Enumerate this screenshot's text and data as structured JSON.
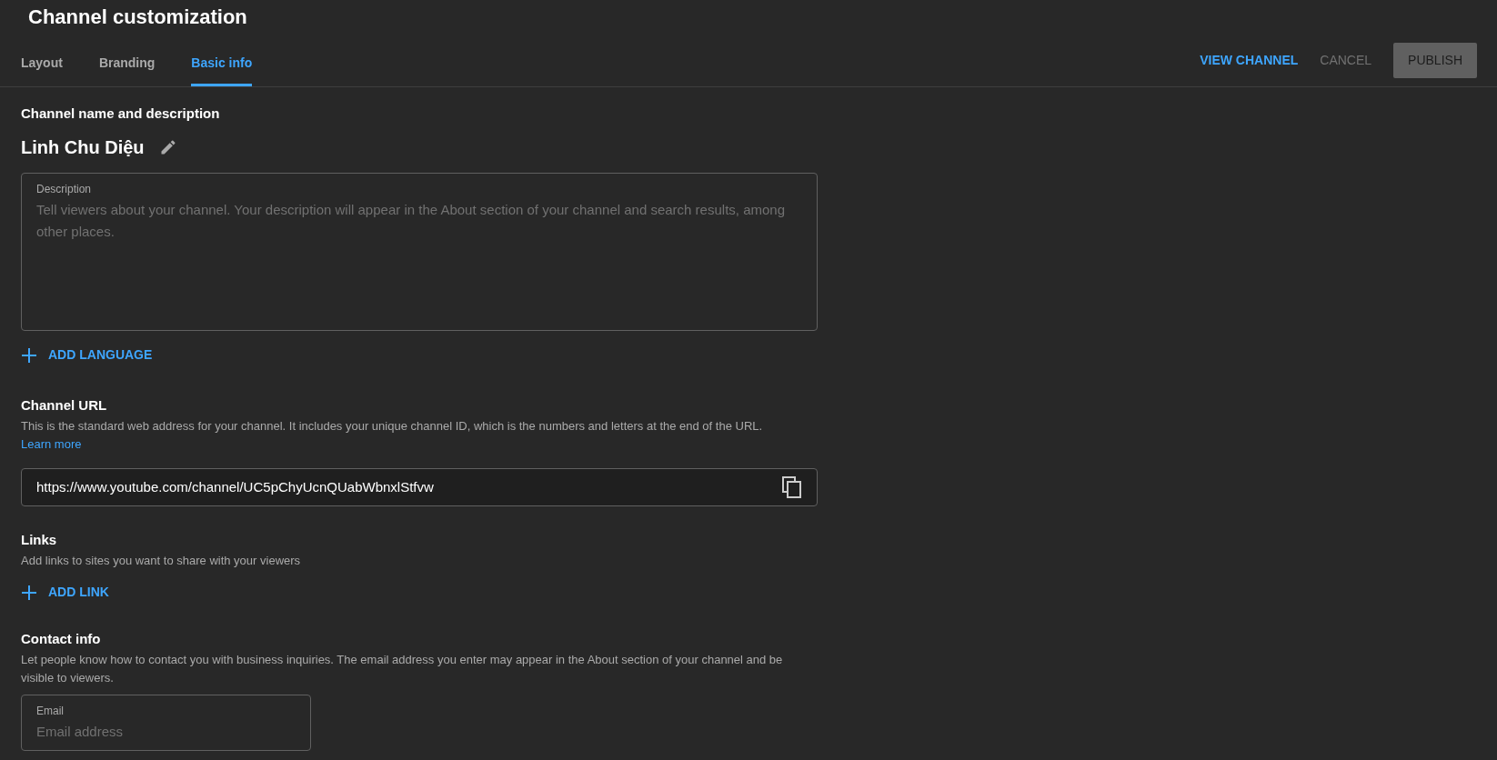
{
  "header": {
    "title": "Channel customization"
  },
  "tabs": [
    {
      "label": "Layout",
      "selected": false
    },
    {
      "label": "Branding",
      "selected": false
    },
    {
      "label": "Basic info",
      "selected": true
    }
  ],
  "actions": [
    {
      "label": "VIEW CHANNEL",
      "kind": "link"
    },
    {
      "label": "CANCEL",
      "kind": "text"
    },
    {
      "label": "PUBLISH",
      "kind": "filled",
      "disabled": true
    }
  ],
  "name_section": {
    "heading": "Channel name and description",
    "channel_name": "Linh Chu Diệu",
    "description_field": {
      "label": "Description",
      "placeholder": "Tell viewers about your channel. Your description will appear in the About section of your channel and search results, among other places."
    },
    "add_button": "ADD LANGUAGE"
  },
  "url_section": {
    "heading": "Channel URL",
    "text": "This is the standard web address for your channel. It includes your unique channel ID, which is the numbers and letters at the end of the URL.",
    "link": "Learn more",
    "url": "https://www.youtube.com/channel/UC5pChyUcnQUabWbnxlStfvw"
  },
  "links_section": {
    "heading": "Links",
    "text": "Add links to sites you want to share with your viewers",
    "add_button": "ADD LINK"
  },
  "contact_section": {
    "heading": "Contact info",
    "text": "Let people know how to contact you with business inquiries. The email address you enter may appear in the About section of your channel and be visible to viewers.",
    "email_field": {
      "label": "Email",
      "placeholder": "Email address"
    }
  }
}
